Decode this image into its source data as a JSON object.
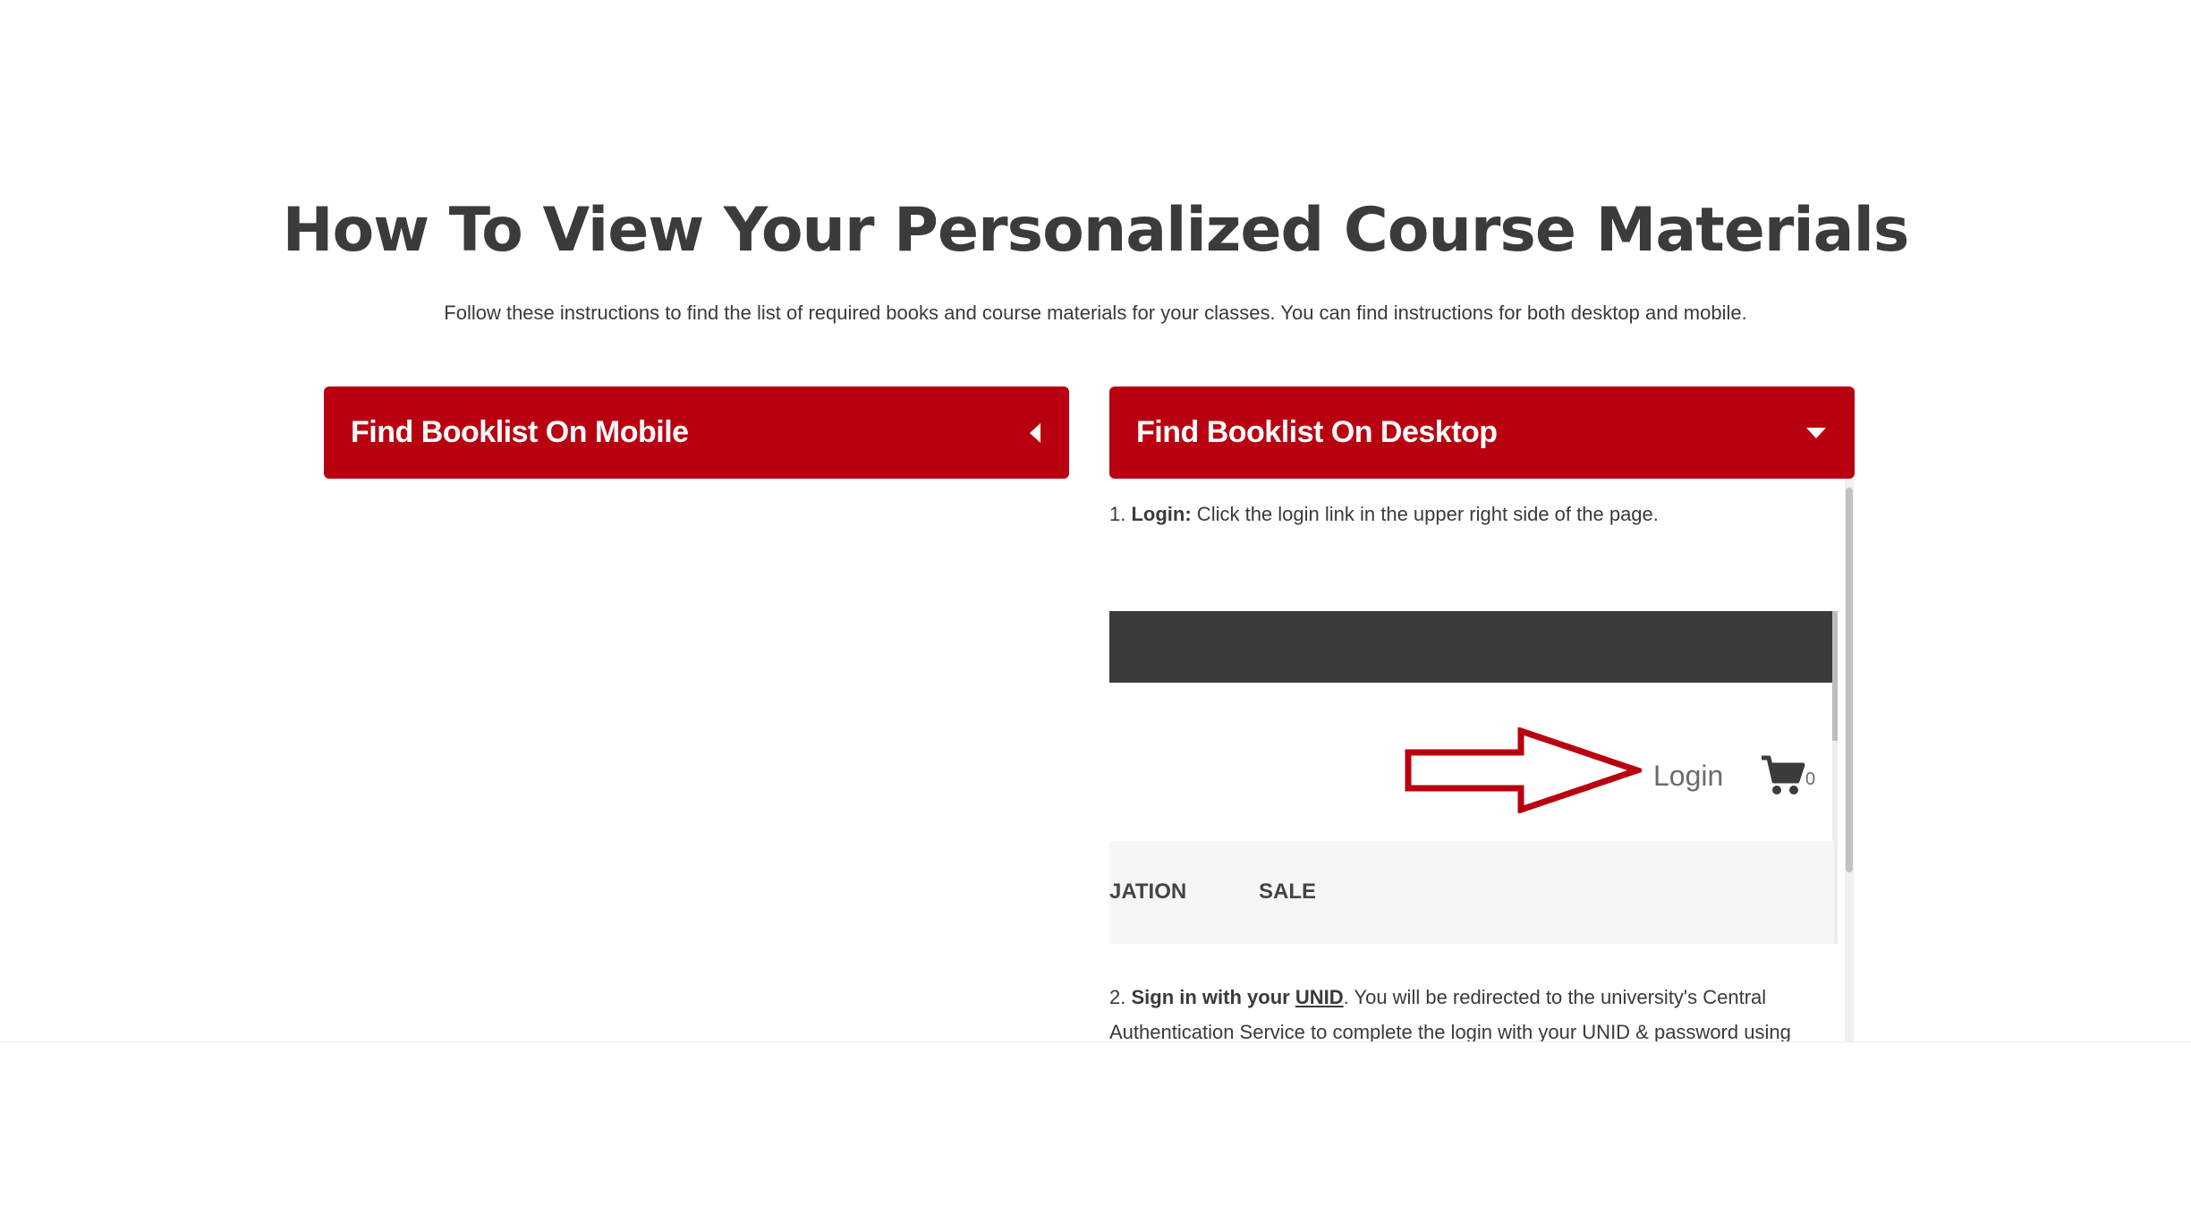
{
  "title": "How To View Your Personalized Course Materials",
  "intro": "Follow these instructions to find the list of required books and course materials for your classes. You can find instructions for both desktop and mobile.",
  "accordions": [
    {
      "label": "Find Booklist On Mobile",
      "expanded": false,
      "icon": "caret-left-icon"
    },
    {
      "label": "Find Booklist On Desktop",
      "expanded": true,
      "icon": "caret-down-icon"
    }
  ],
  "desktop_steps": {
    "step1": {
      "number": "1.",
      "bold": "Login:",
      "text": " Click the login link in the upper right side of the page."
    },
    "step2": {
      "number": "2.",
      "bold": "Sign in with your",
      "link": "UNID",
      "text": ". You will be redirected to the university's Central Authentication Service to complete the login with your UNID & password using two-"
    }
  },
  "screenshot": {
    "login_label": "Login",
    "cart_count": "0",
    "nav_items": [
      "JATION",
      "SALE"
    ],
    "arrow_color": "#b90010",
    "bar_color": "#3b3b3b"
  },
  "colors": {
    "accent": "#b90010",
    "text": "#3a3a3a"
  }
}
